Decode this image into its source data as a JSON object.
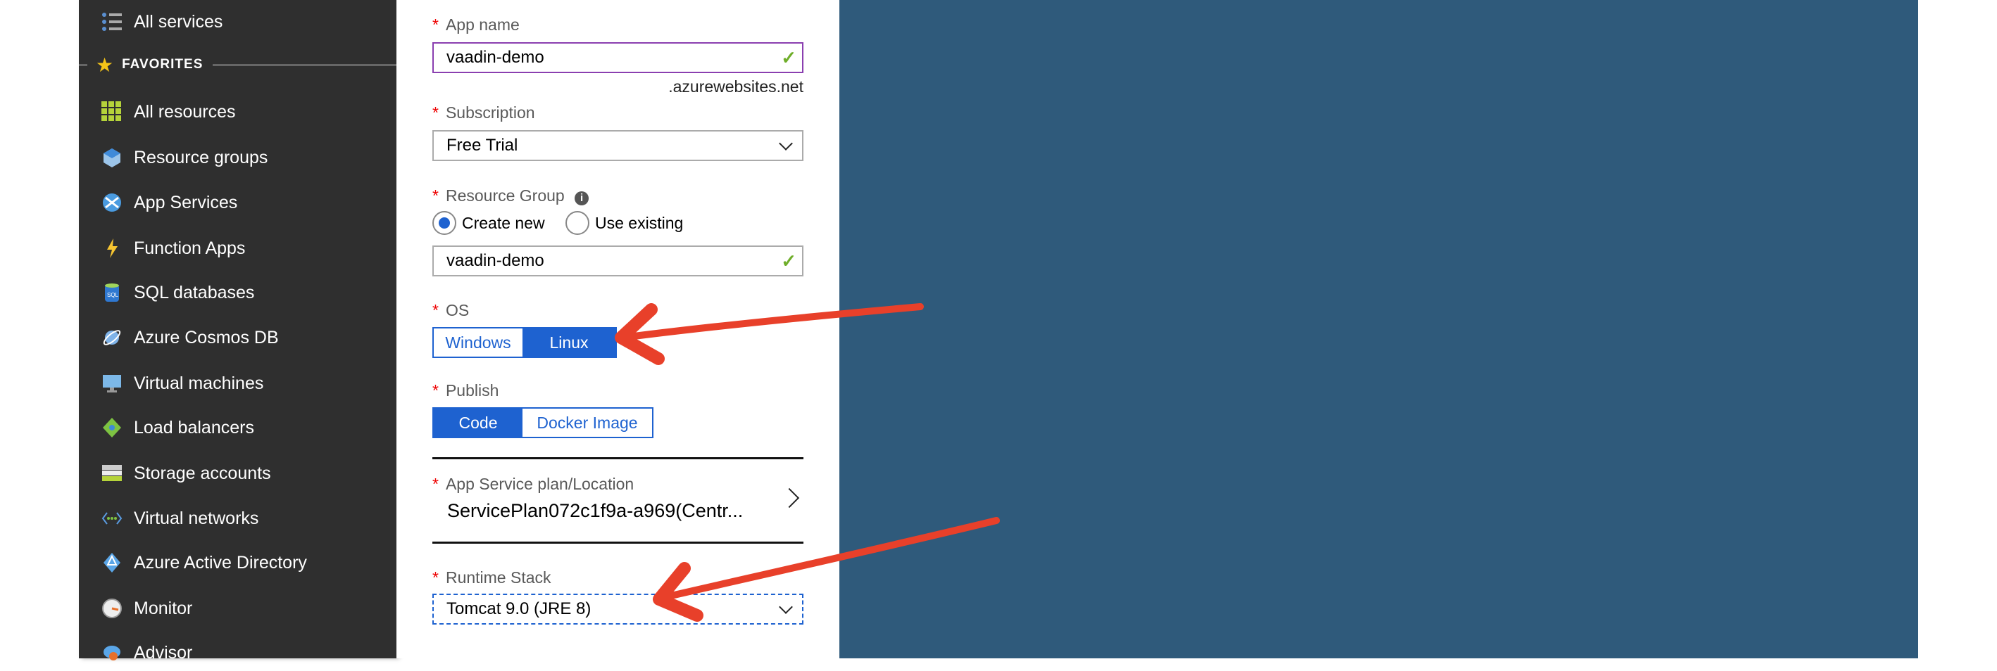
{
  "sidebar": {
    "all_services": "All services",
    "favorites_label": "FAVORITES",
    "items": [
      {
        "label": "All resources",
        "icon": "grid-icon"
      },
      {
        "label": "Resource groups",
        "icon": "cube-icon"
      },
      {
        "label": "App Services",
        "icon": "globe-icon"
      },
      {
        "label": "Function Apps",
        "icon": "lightning-icon"
      },
      {
        "label": "SQL databases",
        "icon": "sql-db-icon"
      },
      {
        "label": "Azure Cosmos DB",
        "icon": "planet-icon"
      },
      {
        "label": "Virtual machines",
        "icon": "monitor-icon"
      },
      {
        "label": "Load balancers",
        "icon": "diamond-icon"
      },
      {
        "label": "Storage accounts",
        "icon": "storage-icon"
      },
      {
        "label": "Virtual networks",
        "icon": "network-icon"
      },
      {
        "label": "Azure Active Directory",
        "icon": "aad-icon"
      },
      {
        "label": "Monitor",
        "icon": "gauge-icon"
      },
      {
        "label": "Advisor",
        "icon": "cloud-icon"
      }
    ]
  },
  "form": {
    "required_mark": "*",
    "app_name_label": "App name",
    "app_name_value": "vaadin-demo",
    "app_name_suffix": ".azurewebsites.net",
    "subscription_label": "Subscription",
    "subscription_value": "Free Trial",
    "resource_group_label": "Resource Group",
    "rg_create": "Create new",
    "rg_existing": "Use existing",
    "rg_value": "vaadin-demo",
    "os_label": "OS",
    "os_windows": "Windows",
    "os_linux": "Linux",
    "os_selected": "Linux",
    "publish_label": "Publish",
    "publish_code": "Code",
    "publish_docker": "Docker Image",
    "publish_selected": "Code",
    "plan_label": "App Service plan/Location",
    "plan_value": "ServicePlan072c1f9a-a969(Centr...",
    "runtime_label": "Runtime Stack",
    "runtime_value": "Tomcat 9.0 (JRE 8)"
  },
  "colors": {
    "accent": "#1e62d0",
    "annotation": "#e8402a",
    "canvas": "#2f5a7b"
  }
}
